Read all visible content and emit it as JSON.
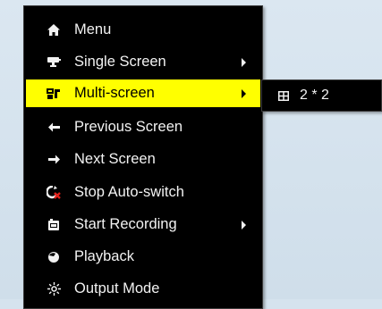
{
  "context_menu": {
    "items": [
      {
        "label": "Menu",
        "icon": "home-icon",
        "has_submenu": false,
        "highlighted": false
      },
      {
        "label": "Single Screen",
        "icon": "camera-icon",
        "has_submenu": true,
        "highlighted": false
      },
      {
        "label": "Multi-screen",
        "icon": "multi-screen-icon",
        "has_submenu": true,
        "highlighted": true
      },
      {
        "label": "Previous Screen",
        "icon": "arrow-left-icon",
        "has_submenu": false,
        "highlighted": false
      },
      {
        "label": "Next Screen",
        "icon": "arrow-right-icon",
        "has_submenu": false,
        "highlighted": false
      },
      {
        "label": "Stop Auto-switch",
        "icon": "stop-auto-switch-icon",
        "has_submenu": false,
        "highlighted": false
      },
      {
        "label": "Start Recording",
        "icon": "record-icon",
        "has_submenu": true,
        "highlighted": false
      },
      {
        "label": "Playback",
        "icon": "playback-icon",
        "has_submenu": false,
        "highlighted": false
      },
      {
        "label": "Output Mode",
        "icon": "output-mode-icon",
        "has_submenu": false,
        "highlighted": false
      }
    ]
  },
  "submenu": {
    "items": [
      {
        "label": "2 * 2",
        "icon": "grid-2x2-icon"
      }
    ]
  },
  "colors": {
    "menu_background": "#000000",
    "menu_text": "#f2f2f2",
    "highlight": "#ffff00",
    "desktop_background": "#d5e3ee",
    "stop_icon_red": "#e0201a"
  }
}
